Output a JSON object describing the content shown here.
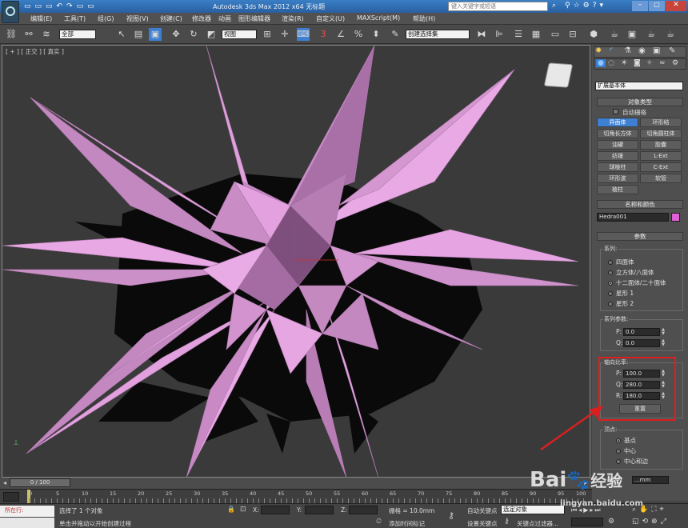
{
  "title": {
    "text": "Autodesk 3ds Max  2012 x64    无标题",
    "search_placeholder": "键入关键字或短语"
  },
  "menu": [
    "编辑(E)",
    "工具(T)",
    "组(G)",
    "视图(V)",
    "创建(C)",
    "修改器",
    "动画",
    "图形编辑器",
    "渲染(R)",
    "自定义(U)",
    "MAXScript(M)",
    "帮助(H)"
  ],
  "toolbar": {
    "selection_filter": "全部",
    "view_combo": "视图",
    "named_selection": "创建选择集"
  },
  "viewport": {
    "label": "[ + ] [ 正交 ] [ 真实 ]",
    "object_color": "#e89ae0"
  },
  "panel": {
    "category": "扩展基本体",
    "object_type_title": "对象类型",
    "autogrid_label": "自动栅格",
    "buttons": [
      [
        "异面体",
        "环形结"
      ],
      [
        "切角长方体",
        "切角圆柱体"
      ],
      [
        "油罐",
        "胶囊"
      ],
      [
        "纺锤",
        "L-Ext"
      ],
      [
        "球棱柱",
        "C-Ext"
      ],
      [
        "环形波",
        "软管"
      ],
      [
        "棱柱",
        ""
      ]
    ],
    "active_button": "异面体",
    "name_color_title": "名称和颜色",
    "object_name": "Hedra001",
    "swatch_color": "#e060d8",
    "params_title": "参数",
    "family_group": "系列:",
    "family_options": [
      "四面体",
      "立方体/八面体",
      "十二面体/二十面体",
      "星形 1",
      "星形 2"
    ],
    "family_selected": 2,
    "family_params_group": "系列参数:",
    "family_params": [
      {
        "label": "P:",
        "value": "0.0"
      },
      {
        "label": "Q:",
        "value": "0.0"
      }
    ],
    "axis_group": "轴向比率:",
    "axis": [
      {
        "label": "P:",
        "value": "100.0"
      },
      {
        "label": "Q:",
        "value": "280.0"
      },
      {
        "label": "R:",
        "value": "180.0"
      }
    ],
    "reset_label": "重置",
    "vertex_group": "顶点:",
    "vertex_options": [
      "基点",
      "中心",
      "中心和边"
    ],
    "vertex_selected": 0,
    "radius_label": "半径:",
    "radius_value": "...mm"
  },
  "timeline": {
    "frame": "0 / 100",
    "ticks": [
      "0",
      "5",
      "10",
      "15",
      "20",
      "25",
      "30",
      "35",
      "40",
      "45",
      "50",
      "55",
      "60",
      "65",
      "70",
      "75",
      "80",
      "85",
      "90",
      "95",
      "100"
    ]
  },
  "status": {
    "max_label": "所在行:",
    "selected": "选择了 1 个对象",
    "prompt": "单击并拖动以开始创建过程",
    "x_label": "X:",
    "y_label": "Y:",
    "z_label": "Z:",
    "grid": "栅格 = 10.0mm",
    "add_tag": "添加时间标记",
    "autokey": "自动关键点",
    "setkey": "设置关键点",
    "key_filter_combo": "选定对象",
    "key_filters": "关键点过滤器..."
  },
  "watermark": {
    "brand": "Bai",
    "brand2": "经验",
    "url": "jingyan.baidu.com"
  }
}
